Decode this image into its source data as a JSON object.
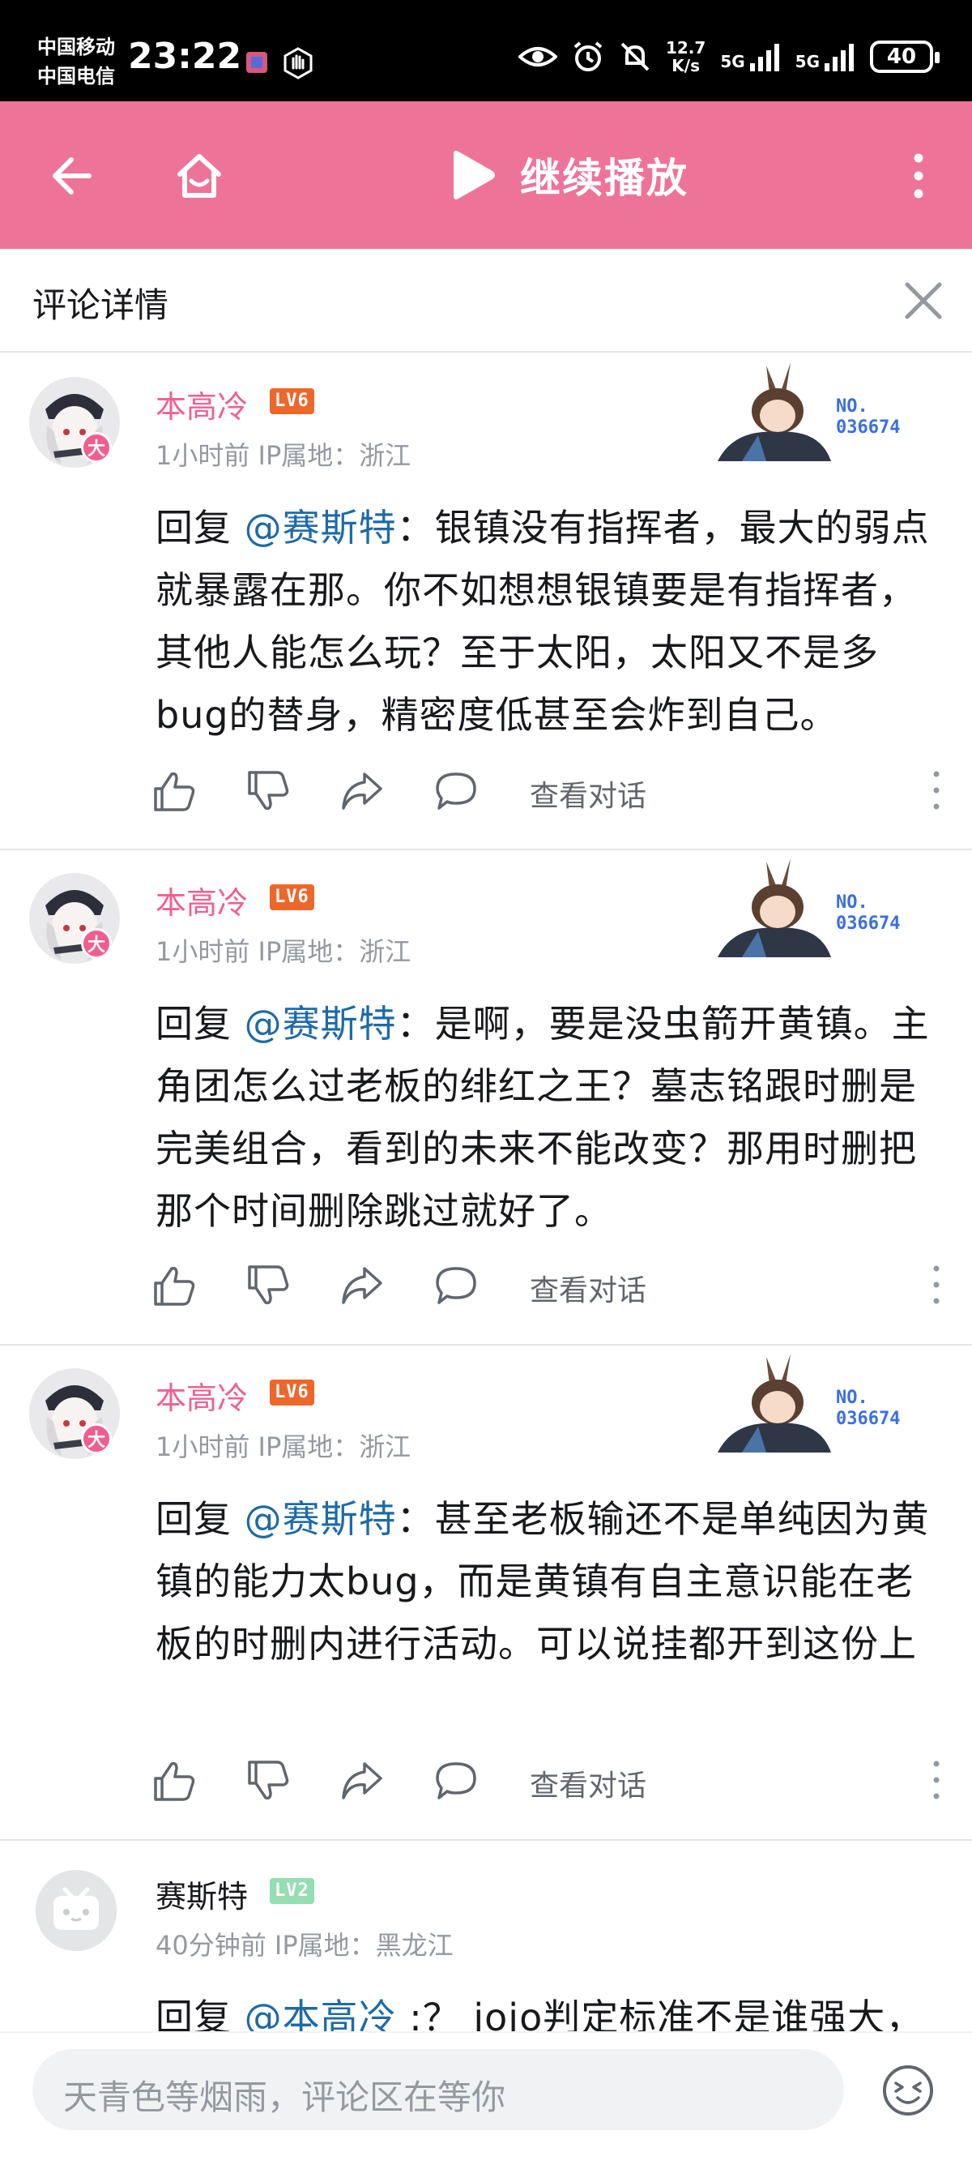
{
  "status_bar": {
    "carrier_1": "中国移动",
    "carrier_2": "中国电信",
    "time": "23:22",
    "speed_value": "12.7",
    "speed_unit": "K/s",
    "net_1": "5G",
    "net_2": "5G",
    "battery": "40"
  },
  "top_bar": {
    "continue_label": "继续播放",
    "background_color": "#ee7399"
  },
  "panel": {
    "title": "评论详情"
  },
  "comments": [
    {
      "username": "本高冷",
      "level": "LV6",
      "avatar_badge": "大",
      "time": "1小时前",
      "ip": "IP属地：浙江",
      "card_no_label": "NO.",
      "card_no_value": "036674",
      "reply_prefix": "回复 ",
      "mention": "@赛斯特",
      "text": "：银镇没有指挥者，最大的弱点就暴露在那。你不如想想银镇要是有指挥者，其他人能怎么玩？至于太阳，太阳又不是多bug的替身，精密度低甚至会炸到自己。",
      "view_conversation": "查看对话"
    },
    {
      "username": "本高冷",
      "level": "LV6",
      "avatar_badge": "大",
      "time": "1小时前",
      "ip": "IP属地：浙江",
      "card_no_label": "NO.",
      "card_no_value": "036674",
      "reply_prefix": "回复 ",
      "mention": "@赛斯特",
      "text": "：是啊，要是没虫箭开黄镇。主角团怎么过老板的绯红之王？墓志铭跟时删是完美组合，看到的未来不能改变？那用时删把那个时间删除跳过就好了。",
      "view_conversation": "查看对话"
    },
    {
      "username": "本高冷",
      "level": "LV6",
      "avatar_badge": "大",
      "time": "1小时前",
      "ip": "IP属地：浙江",
      "card_no_label": "NO.",
      "card_no_value": "036674",
      "reply_prefix": "回复 ",
      "mention": "@赛斯特",
      "text": "：甚至老板输还不是单纯因为黄镇的能力太bug，而是黄镇有自主意识能在老板的时删内进行活动。可以说挂都开到这份上",
      "view_conversation": "查看对话"
    },
    {
      "username": "赛斯特",
      "level": "LV2",
      "time": "40分钟前",
      "ip": "IP属地：黑龙江",
      "reply_prefix": "回复 ",
      "mention": "@本高冷",
      "text": " :？ jojo判定标准不是谁强大，"
    }
  ],
  "input": {
    "placeholder": "天青色等烟雨，评论区在等你"
  },
  "icons": {
    "back": "back-arrow-icon",
    "home": "home-icon",
    "play": "play-icon",
    "more": "more-vertical-icon",
    "close": "close-icon",
    "like": "thumbs-up-icon",
    "dislike": "thumbs-down-icon",
    "share": "share-icon",
    "reply": "comment-bubble-icon",
    "emoji": "emoji-icon"
  }
}
